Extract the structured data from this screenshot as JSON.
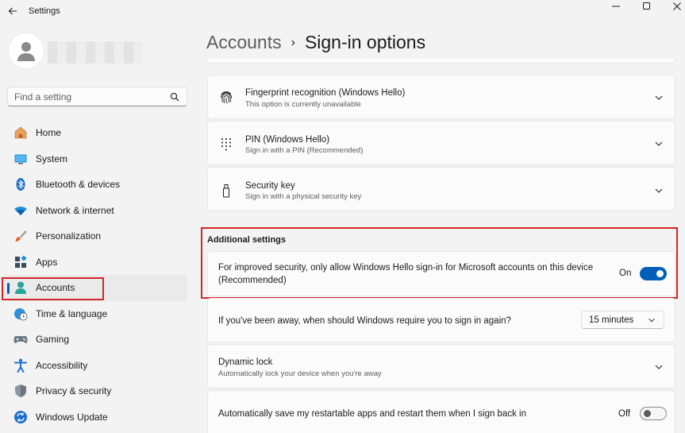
{
  "window": {
    "title": "Settings"
  },
  "search": {
    "placeholder": "Find a setting"
  },
  "sidebar": {
    "items": [
      {
        "label": "Home",
        "icon": "home-icon"
      },
      {
        "label": "System",
        "icon": "system-icon"
      },
      {
        "label": "Bluetooth & devices",
        "icon": "bluetooth-icon"
      },
      {
        "label": "Network & internet",
        "icon": "wifi-icon"
      },
      {
        "label": "Personalization",
        "icon": "brush-icon"
      },
      {
        "label": "Apps",
        "icon": "apps-icon"
      },
      {
        "label": "Accounts",
        "icon": "accounts-icon",
        "active": true
      },
      {
        "label": "Time & language",
        "icon": "globe-clock-icon"
      },
      {
        "label": "Gaming",
        "icon": "gamepad-icon"
      },
      {
        "label": "Accessibility",
        "icon": "accessibility-icon"
      },
      {
        "label": "Privacy & security",
        "icon": "shield-icon"
      },
      {
        "label": "Windows Update",
        "icon": "update-icon"
      }
    ]
  },
  "breadcrumb": {
    "parent": "Accounts",
    "separator": "›",
    "current": "Sign-in options"
  },
  "signin_methods": [
    {
      "title": "Fingerprint recognition (Windows Hello)",
      "subtitle": "This option is currently unavailable",
      "icon": "fingerprint-icon"
    },
    {
      "title": "PIN (Windows Hello)",
      "subtitle": "Sign in with a PIN (Recommended)",
      "icon": "pin-keypad-icon"
    },
    {
      "title": "Security key",
      "subtitle": "Sign in with a physical security key",
      "icon": "security-key-icon"
    }
  ],
  "additional": {
    "heading": "Additional settings",
    "hello_only": {
      "line1": "For improved security, only allow Windows Hello sign-in for Microsoft accounts on this device",
      "line2": "(Recommended)",
      "state": "On"
    },
    "require_signin": {
      "label": "If you've been away, when should Windows require you to sign in again?",
      "value": "15 minutes"
    },
    "dynamic_lock": {
      "title": "Dynamic lock",
      "subtitle": "Automatically lock your device when you're away"
    },
    "restart_apps": {
      "label": "Automatically save my restartable apps and restart them when I sign back in",
      "state": "Off"
    }
  },
  "colors": {
    "accent": "#005fb8",
    "highlight": "#d3262a"
  }
}
